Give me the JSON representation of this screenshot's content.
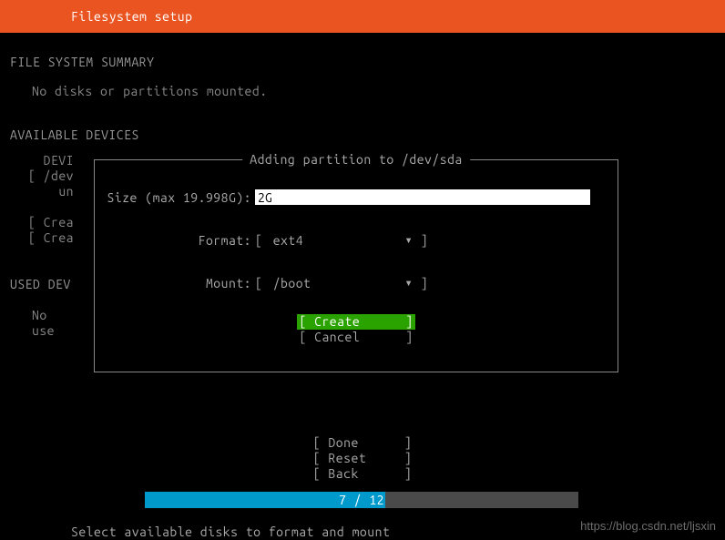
{
  "header": {
    "title": "Filesystem setup"
  },
  "sections": {
    "fss_heading": "FILE SYSTEM SUMMARY",
    "fss_text": "No disks or partitions mounted.",
    "avail_heading": "AVAILABLE DEVICES",
    "used_heading": "USED DEV",
    "used_text": "No use"
  },
  "leftcol": {
    "r1": "DEVI",
    "r2": "[ /dev",
    "r3": "un",
    "r5": "[ Crea",
    "r6": "[ Crea"
  },
  "modal": {
    "title": "Adding partition to /dev/sda",
    "size_label": "Size (max 19.998G):",
    "size_value": "2G",
    "format_label": "Format:",
    "format_value": "ext4",
    "mount_label": "Mount:",
    "mount_value": "/boot",
    "create": "Create",
    "cancel": "Cancel"
  },
  "footer": {
    "done": "Done",
    "reset": "Reset",
    "back": "Back",
    "progress": "7 / 12",
    "hint": "Select available disks to format and mount"
  },
  "watermark": "https://blog.csdn.net/ljsxin"
}
